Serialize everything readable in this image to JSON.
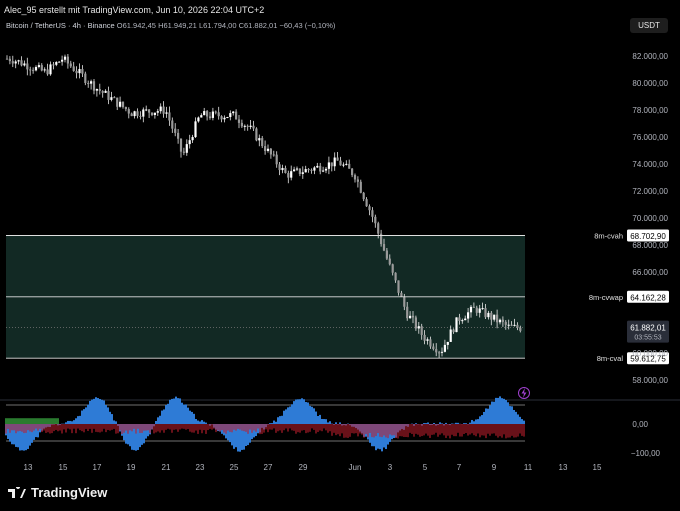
{
  "header": {
    "credit": "Alec_95 erstellt mit TradingView.com, Jun 10, 2026 22:04 UTC+2"
  },
  "legend": {
    "symbol": "Bitcoin / TetherUS · 4h · Binance",
    "open": "O61.942,45",
    "high": "H61.949,21",
    "low": "L61.794,00",
    "close": "C61.882,01",
    "change": "−60,43 (−0,10%)"
  },
  "quote_currency": "USDT",
  "footer": {
    "brand": "TradingView"
  },
  "colors": {
    "background": "#000000",
    "candle": "#e8e8e8",
    "zone_fill": "#15302a",
    "level_line": "#e0e0e0",
    "price_tag": "#ffffff",
    "osc_blue": "#2e7bd6",
    "osc_red": "#c0202e",
    "osc_green": "#3cb043",
    "osc_yellow": "#e0c030"
  },
  "chart_data": {
    "type": "candlestick",
    "title": "Bitcoin / TetherUS · 4h · Binance",
    "xlabel": "",
    "ylabel": "",
    "ylim": [
      56000,
      84000
    ],
    "y_ticks": [
      "82.000,00",
      "80.000,00",
      "78.000,00",
      "76.000,00",
      "74.000,00",
      "72.000,00",
      "70.000,00",
      "68.000,00",
      "66.000,00",
      "60.000,00",
      "58.000,00"
    ],
    "x_ticks": [
      "13",
      "15",
      "17",
      "19",
      "21",
      "23",
      "25",
      "27",
      "29",
      "Jun",
      "3",
      "5",
      "7",
      "9",
      "11",
      "13",
      "15"
    ],
    "candle_summary": {
      "timeframe": "4h",
      "approx_path": [
        {
          "date": "May 12",
          "price": 81800
        },
        {
          "date": "May 14",
          "price": 80800
        },
        {
          "date": "May 15",
          "price": 81800
        },
        {
          "date": "May 17",
          "price": 79600
        },
        {
          "date": "May 19",
          "price": 77800
        },
        {
          "date": "May 21",
          "price": 78000
        },
        {
          "date": "May 22",
          "price": 74600
        },
        {
          "date": "May 23",
          "price": 77600
        },
        {
          "date": "May 25",
          "price": 77600
        },
        {
          "date": "May 26",
          "price": 76500
        },
        {
          "date": "May 28",
          "price": 73200
        },
        {
          "date": "May 30",
          "price": 73800
        },
        {
          "date": "May 31",
          "price": 74200
        },
        {
          "date": "Jun 1",
          "price": 73200
        },
        {
          "date": "Jun 2",
          "price": 70200
        },
        {
          "date": "Jun 3",
          "price": 66500
        },
        {
          "date": "Jun 4",
          "price": 63000
        },
        {
          "date": "Jun 5",
          "price": 61200
        },
        {
          "date": "Jun 6",
          "price": 60100
        },
        {
          "date": "Jun 7",
          "price": 62500
        },
        {
          "date": "Jun 8",
          "price": 63300
        },
        {
          "date": "Jun 9",
          "price": 62600
        },
        {
          "date": "Jun 10",
          "price": 61882
        }
      ]
    },
    "levels": [
      {
        "name": "8m-cvah",
        "value": 68702.9,
        "label": "68.702,90"
      },
      {
        "name": "8m-cvwap",
        "value": 64162.28,
        "label": "64.162,28"
      },
      {
        "name": "8m-cval",
        "value": 59612.75,
        "label": "59.612,75"
      }
    ],
    "last_price": {
      "value": 61882.01,
      "label": "61.882,01",
      "countdown": "03:55:53"
    },
    "oscillator": {
      "y_ticks": [
        "0,00",
        "−100,00"
      ],
      "ylim": [
        -130,
        60
      ]
    }
  }
}
